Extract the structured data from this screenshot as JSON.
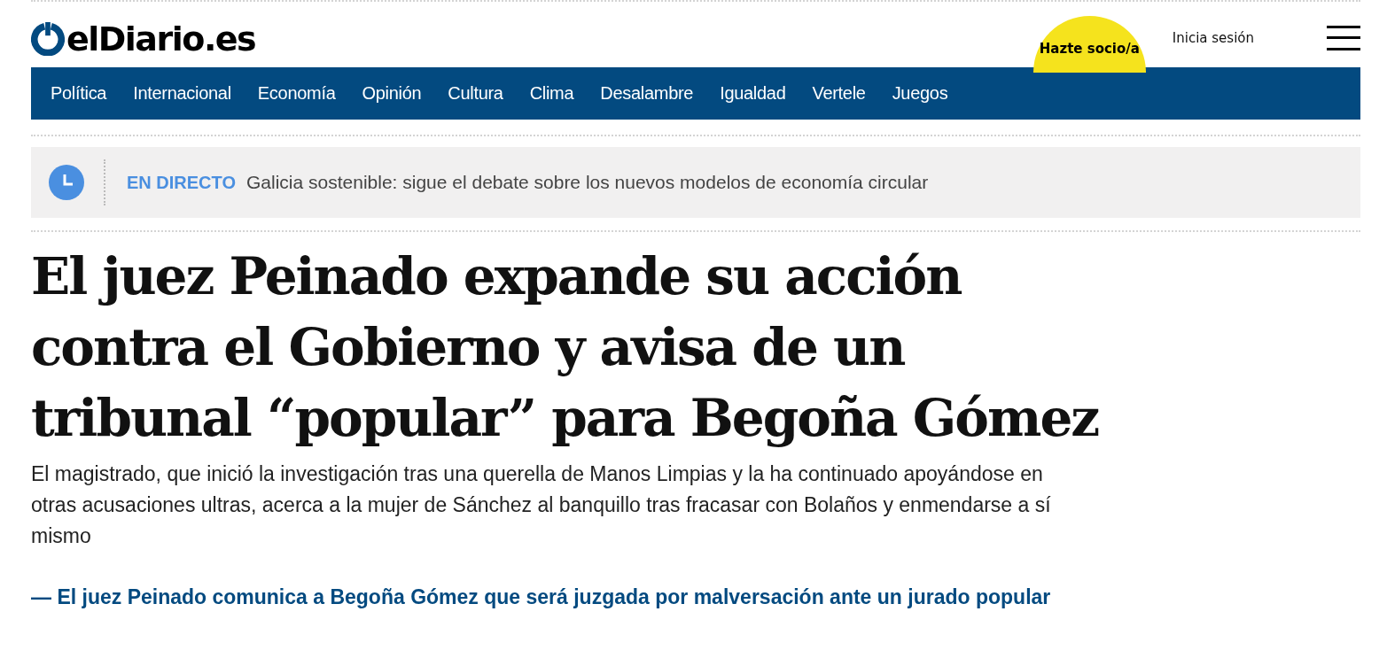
{
  "header": {
    "logo": "elDiario.es",
    "subscribe": "Hazte socio/a",
    "login": "Inicia sesión"
  },
  "nav": [
    "Política",
    "Internacional",
    "Economía",
    "Opinión",
    "Cultura",
    "Clima",
    "Desalambre",
    "Igualdad",
    "Vertele",
    "Juegos"
  ],
  "live": {
    "label": "EN DIRECTO",
    "text": "Galicia sostenible: sigue el debate sobre los nuevos modelos de economía circular"
  },
  "article": {
    "headline": "El juez Peinado expande su acción contra el Gobierno y avisa de un tribunal “popular” para Begoña Gómez",
    "summary": "El magistrado, que inició la investigación tras una querella de Manos Limpias y la ha continuado apoyándose en otras acusaciones ultras, acerca a la mujer de Sánchez al banquillo tras fracasar con Bolaños y enmendarse a sí mismo",
    "related": "— El juez Peinado comunica a Begoña Gómez que será juzgada por malversación ante un jurado popular"
  }
}
